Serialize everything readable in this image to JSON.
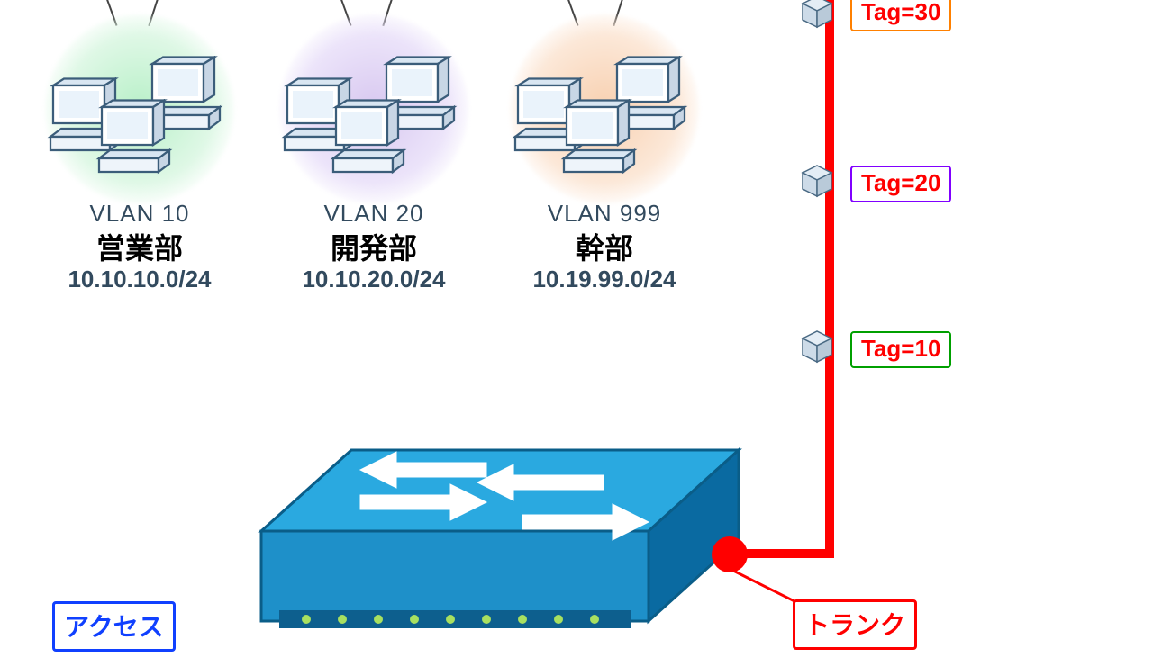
{
  "vlans": [
    {
      "id": "vlan10",
      "label": "VLAN 10",
      "dept": "営業部",
      "subnet": "10.10.10.0/24",
      "halo": "green"
    },
    {
      "id": "vlan20",
      "label": "VLAN 20",
      "dept": "開発部",
      "subnet": "10.10.20.0/24",
      "halo": "purple"
    },
    {
      "id": "vlan999",
      "label": "VLAN 999",
      "dept": "幹部",
      "subnet": "10.19.99.0/24",
      "halo": "orange"
    }
  ],
  "tags": [
    {
      "id": "tag30",
      "text": "Tag=30",
      "border": "#ff8000"
    },
    {
      "id": "tag20",
      "text": "Tag=20",
      "border": "#8000ff"
    },
    {
      "id": "tag10",
      "text": "Tag=10",
      "border": "#00a000"
    }
  ],
  "access_label": "アクセス",
  "trunk_label": "トランク",
  "colors": {
    "trunk_line": "#ff0000",
    "switch_top": "#29abe2",
    "switch_side": "#0a6aa1"
  }
}
